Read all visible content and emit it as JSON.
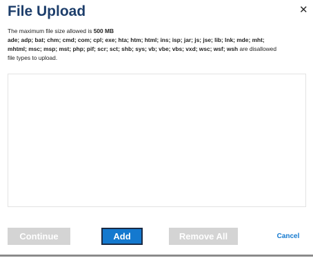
{
  "dialog": {
    "title": "File Upload",
    "close_icon": "close-icon"
  },
  "info": {
    "max_size_prefix": "The maximum file size allowed is ",
    "max_size_value": "500 MB",
    "disallowed_line1": "ade; adp; bat; chm; cmd; com; cpl; exe; hta; htm; html; ins; isp; jar; js; jse; lib; lnk; mde; mht;",
    "disallowed_line2": "mhtml; msc; msp; mst; php; pif; scr; sct; shb; sys; vb; vbe; vbs; vxd; wsc; wsf; wsh",
    "disallowed_suffix": " are disallowed",
    "disallowed_line3": "file types to upload."
  },
  "buttons": {
    "continue_label": "Continue",
    "add_label": "Add",
    "remove_all_label": "Remove All",
    "cancel_label": "Cancel"
  },
  "colors": {
    "title": "#1d3e6b",
    "primary": "#1479cf",
    "disabled": "#d4d4d4"
  }
}
